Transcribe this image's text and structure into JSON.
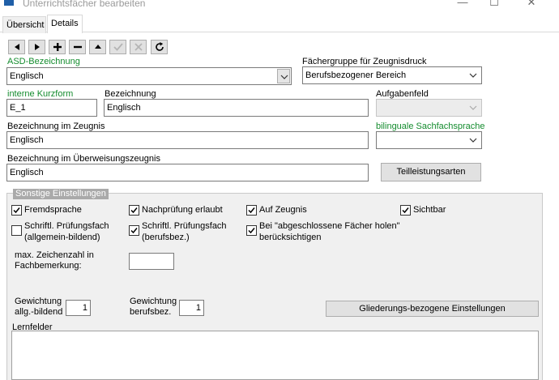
{
  "window": {
    "title": "Unterrichtsfächer bearbeiten"
  },
  "tabs": [
    {
      "label": "Übersicht"
    },
    {
      "label": "Details"
    }
  ],
  "toolbar": {
    "icons": [
      "arrow-left-icon",
      "arrow-right-icon",
      "plus-icon",
      "minus-icon",
      "arrow-up-icon",
      "check-icon",
      "cancel-icon",
      "refresh-icon"
    ]
  },
  "form": {
    "asd_label": "ASD-Bezeichnung",
    "asd_value": "Englisch",
    "faechergruppe_label": "Fächergruppe für Zeugnisdruck",
    "faechergruppe_value": "Berufsbezogener Bereich",
    "kurzform_label": "interne Kurzform",
    "kurzform_value": "E_1",
    "bezeichnung_label": "Bezeichnung",
    "bezeichnung_value": "Englisch",
    "aufgabenfeld_label": "Aufgabenfeld",
    "aufgabenfeld_value": "",
    "zeugnis_label": "Bezeichnung im Zeugnis",
    "zeugnis_value": "Englisch",
    "bilingual_label": "bilinguale Sachfachsprache",
    "bilingual_value": "",
    "ueberweisung_label": "Bezeichnung im Überweisungszeugnis",
    "ueberweisung_value": "Englisch",
    "teilleistung_button": "Teilleistungsarten"
  },
  "settings": {
    "title": "Sonstige Einstellungen",
    "checkboxes": [
      {
        "label": "Fremdsprache",
        "checked": true
      },
      {
        "label": "Nachprüfung erlaubt",
        "checked": true
      },
      {
        "label": "Auf Zeugnis",
        "checked": true
      },
      {
        "label": "Sichtbar",
        "checked": true
      },
      {
        "label": "Schriftl. Prüfungsfach",
        "label2": "(allgemein-bildend)",
        "checked": false
      },
      {
        "label": "Schriftl. Prüfungsfach",
        "label2": "(berufsbez.)",
        "checked": true
      },
      {
        "label": "Bei \"abgeschlossene Fächer holen\"",
        "label2": "berücksichtigen",
        "checked": true
      }
    ],
    "max_zeichen_label1": "max. Zeichenzahl in",
    "max_zeichen_label2": "Fachbemerkung:",
    "max_zeichen_value": "",
    "gewichtung_allg_label1": "Gewichtung",
    "gewichtung_allg_label2": "allg.-bildend",
    "gewichtung_allg_value": "1",
    "gewichtung_beruf_label1": "Gewichtung",
    "gewichtung_beruf_label2": "berufsbez.",
    "gewichtung_beruf_value": "1",
    "gliederung_button": "Gliederungs-bezogene Einstellungen",
    "lernfelder_label": "Lernfelder",
    "lernfelder_value": ""
  },
  "colors": {
    "green_label": "#148c2e",
    "panel_bg": "#f0f0f0",
    "group_title_bg": "#aaaaaa"
  }
}
